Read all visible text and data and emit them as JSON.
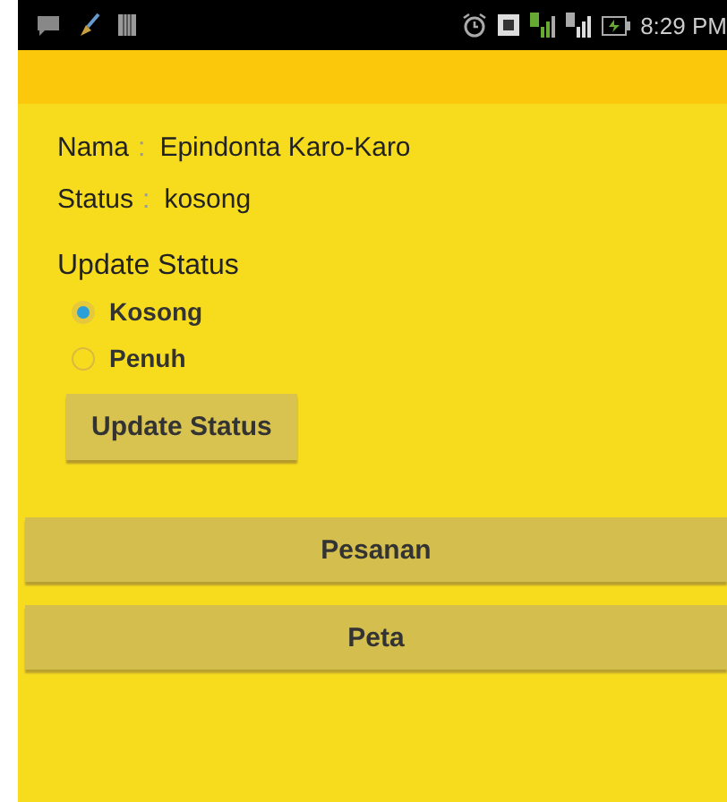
{
  "status_bar": {
    "time": "8:29 PM"
  },
  "profile": [
    {
      "label": "Nama",
      "separator": ":",
      "value": "Epindonta Karo-Karo"
    },
    {
      "label": "Status",
      "separator": ":",
      "value": "kosong"
    }
  ],
  "update_status": {
    "title": "Update Status",
    "options": [
      {
        "label": "Kosong",
        "selected": true
      },
      {
        "label": "Penuh",
        "selected": false
      }
    ],
    "button": "Update Status"
  },
  "actions": [
    "Pesanan",
    "Peta"
  ]
}
